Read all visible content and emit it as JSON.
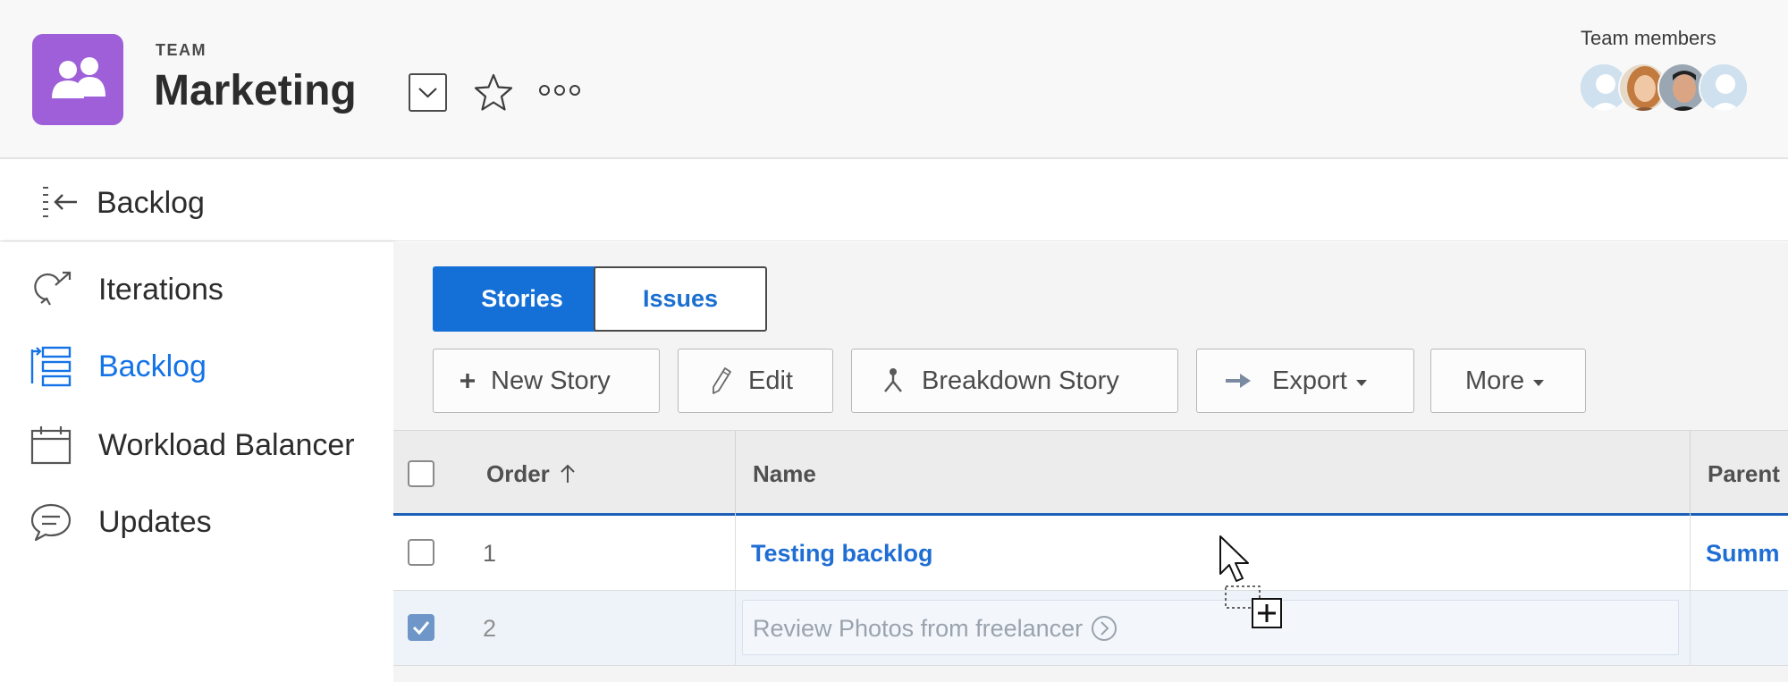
{
  "header": {
    "team_label": "TEAM",
    "team_name": "Marketing",
    "members_label": "Team members",
    "colors": {
      "logo": "#9e5fd9",
      "accent": "#1473e6"
    }
  },
  "breadcrumb": {
    "title": "Backlog"
  },
  "sidebar": {
    "items": [
      {
        "label": "Iterations",
        "icon": "iterations-icon"
      },
      {
        "label": "Backlog",
        "icon": "backlog-icon",
        "active": true
      },
      {
        "label": "Workload Balancer",
        "icon": "calendar-icon"
      },
      {
        "label": "Updates",
        "icon": "chat-bubble-icon"
      }
    ]
  },
  "main": {
    "tabs": [
      {
        "label": "Stories",
        "active": true
      },
      {
        "label": "Issues",
        "active": false
      }
    ],
    "toolbar": {
      "new_story": "New Story",
      "edit": "Edit",
      "breakdown": "Breakdown Story",
      "export": "Export",
      "more": "More"
    },
    "table": {
      "columns": {
        "order": "Order",
        "name": "Name",
        "parent": "Parent"
      },
      "rows": [
        {
          "order": "1",
          "name": "Testing backlog",
          "parent": "Summ",
          "checked": false
        },
        {
          "order": "2",
          "name": "Review Photos from freelancer",
          "parent": "",
          "checked": true
        }
      ]
    }
  }
}
